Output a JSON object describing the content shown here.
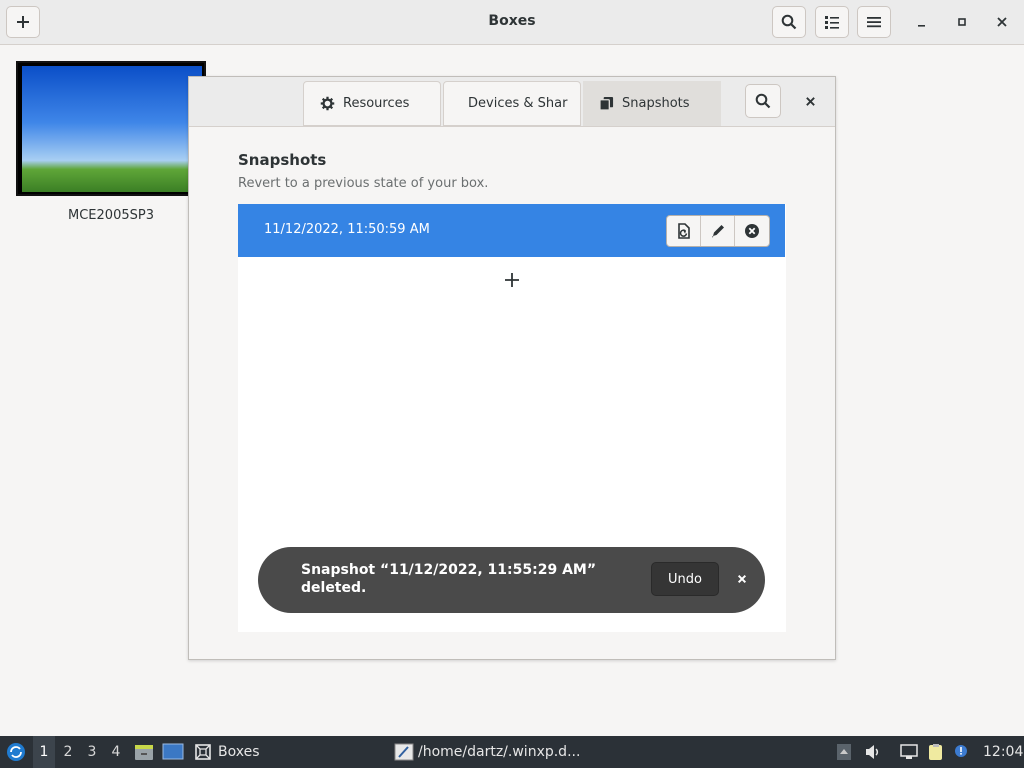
{
  "header": {
    "title": "Boxes",
    "new_icon": "plus-icon",
    "search_icon": "search-icon",
    "view_icon": "list-view-icon",
    "menu_icon": "hamburger-menu-icon"
  },
  "window_controls": {
    "minimize": "–",
    "maximize": "▫",
    "close": "✕"
  },
  "boxes": [
    {
      "name": "MCE2005SP3"
    }
  ],
  "dialog": {
    "tabs": [
      {
        "label": "Resources",
        "icon": "gear-icon"
      },
      {
        "label": "Devices & Shar",
        "icon": "mouse-icon"
      },
      {
        "label": "Snapshots",
        "icon": "snapshots-icon"
      }
    ],
    "close": "✕",
    "section_title": "Snapshots",
    "section_subtitle": "Revert to a previous state of your box.",
    "snapshots": [
      {
        "label": "11/12/2022, 11:50:59 AM"
      }
    ],
    "toast": {
      "message": "Snapshot “11/12/2022, 11:55:29 AM” deleted.",
      "undo_label": "Undo",
      "close": "✕"
    }
  },
  "taskbar": {
    "workspaces": [
      "1",
      "2",
      "3",
      "4"
    ],
    "active_workspace": "1",
    "apps": [
      {
        "label": "Boxes",
        "icon": "boxes-icon"
      },
      {
        "label": "/home/dartz/.winxp.d...",
        "icon": "text-editor-icon"
      }
    ],
    "clock": "12:04"
  },
  "colors": {
    "accent": "#3584e4",
    "toast_bg": "#4a4a4a",
    "taskbar_bg": "#2b3137"
  }
}
